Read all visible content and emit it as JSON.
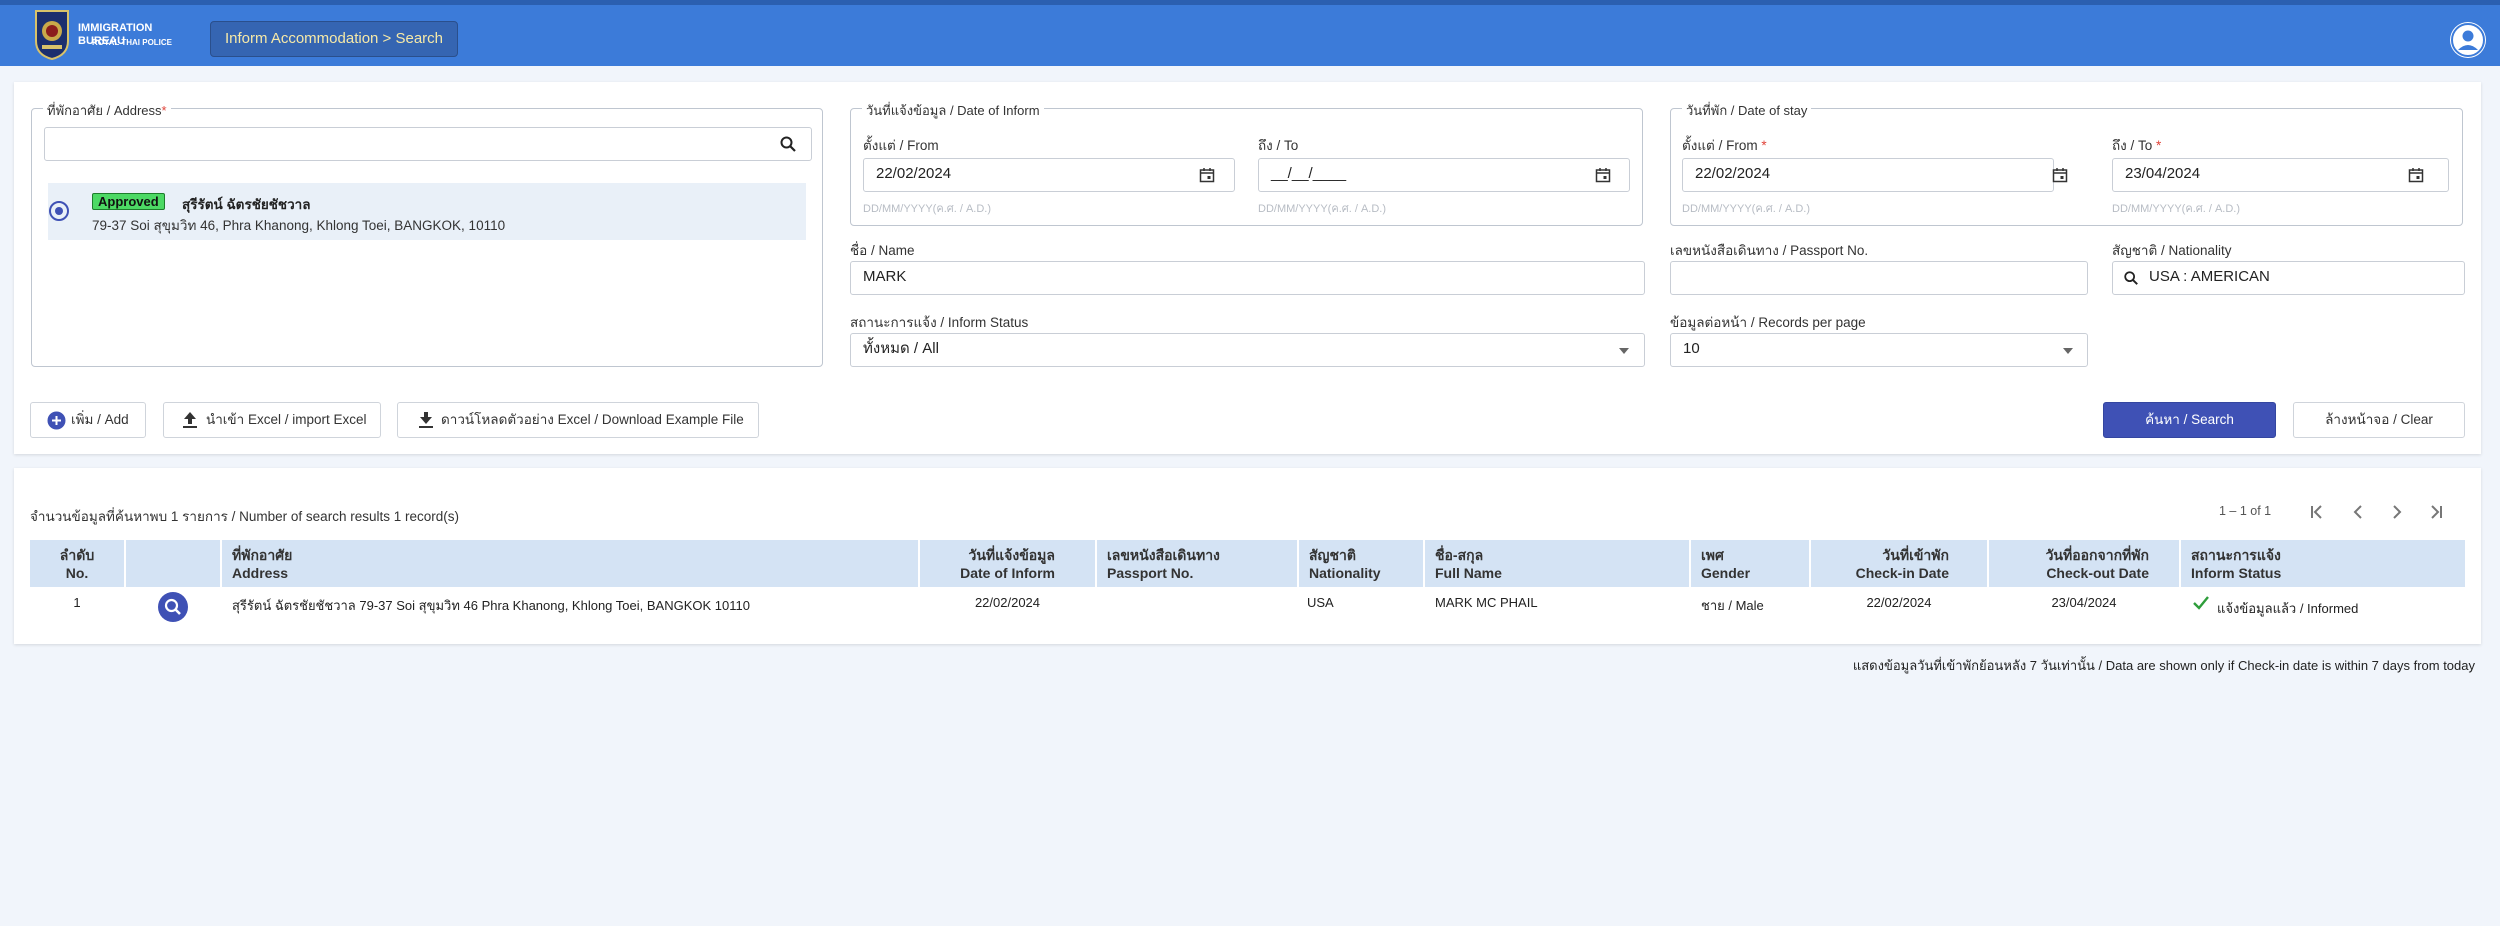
{
  "header": {
    "logo_line1": "IMMIGRATION BUREAU",
    "logo_line2": "ROYAL THAI POLICE",
    "breadcrumb": "Inform Accommodation > Search"
  },
  "address": {
    "legend": "ที่พักอาศัย / Address",
    "search_value": "",
    "item": {
      "badge": "Approved",
      "name": "สุรีรัตน์ ฉัตรชัยชัชวาล",
      "address": "79-37 Soi สุขุมวิท 46, Phra Khanong, Khlong Toei, BANGKOK, 10110"
    }
  },
  "date_inform": {
    "legend": "วันที่แจ้งข้อมูล / Date of Inform",
    "from_label": "ตั้งแต่ / From",
    "from_value": "22/02/2024",
    "from_hint": "DD/MM/YYYY(ค.ศ. / A.D.)",
    "to_label": "ถึง / To",
    "to_value": "__/__/____",
    "to_hint": "DD/MM/YYYY(ค.ศ. / A.D.)"
  },
  "date_stay": {
    "legend": "วันที่พัก / Date of stay",
    "from_label": "ตั้งแต่ / From",
    "from_value": "22/02/2024",
    "from_hint": "DD/MM/YYYY(ค.ศ. / A.D.)",
    "to_label": "ถึง / To",
    "to_value": "23/04/2024",
    "to_hint": "DD/MM/YYYY(ค.ศ. / A.D.)"
  },
  "name": {
    "label": "ชื่อ / Name",
    "value": "MARK"
  },
  "passport": {
    "label": "เลขหนังสือเดินทาง / Passport No.",
    "value": ""
  },
  "nationality": {
    "label": "สัญชาติ / Nationality",
    "value": "USA : AMERICAN"
  },
  "inform_status": {
    "label": "สถานะการแจ้ง / Inform Status",
    "value": "ทั้งหมด / All"
  },
  "records_per_page": {
    "label": "ข้อมูลต่อหน้า / Records per page",
    "value": "10"
  },
  "buttons": {
    "add": "เพิ่ม / Add",
    "import": "นำเข้า Excel / import Excel",
    "download": "ดาวน์โหลดตัวอย่าง Excel / Download Example File",
    "search": "ค้นหา / Search",
    "clear": "ล้างหน้าจอ / Clear"
  },
  "results": {
    "count_text": "จำนวนข้อมูลที่ค้นหาพบ 1 รายการ / Number of search results 1 record(s)",
    "pagination": "1 – 1 of 1",
    "columns": [
      {
        "th": "ลำดับ",
        "en": "No."
      },
      {
        "th": "",
        "en": ""
      },
      {
        "th": "ที่พักอาศัย",
        "en": "Address"
      },
      {
        "th": "วันที่แจ้งข้อมูล",
        "en": "Date of Inform"
      },
      {
        "th": "เลขหนังสือเดินทาง",
        "en": "Passport No."
      },
      {
        "th": "สัญชาติ",
        "en": "Nationality"
      },
      {
        "th": "ชื่อ-สกุล",
        "en": "Full Name"
      },
      {
        "th": "เพศ",
        "en": "Gender"
      },
      {
        "th": "วันที่เข้าพัก",
        "en": "Check-in Date"
      },
      {
        "th": "วันที่ออกจากที่พัก",
        "en": "Check-out Date"
      },
      {
        "th": "สถานะการแจ้ง",
        "en": "Inform Status"
      }
    ],
    "row": {
      "no": "1",
      "address": "สุรีรัตน์ ฉัตรชัยชัชวาล 79-37 Soi สุขุมวิท 46 Phra Khanong, Khlong Toei, BANGKOK 10110",
      "date_inform": "22/02/2024",
      "passport": "",
      "nationality": "USA",
      "full_name": "MARK MC PHAIL",
      "gender": "ชาย / Male",
      "checkin": "22/02/2024",
      "checkout": "23/04/2024",
      "status": "แจ้งข้อมูลแล้ว / Informed"
    }
  },
  "footer_note": "แสดงข้อมูลวันที่เข้าพักย้อนหลัง 7 วันเท่านั้น / Data are shown only if Check-in date is within 7 days from today",
  "colors": {
    "header": "#3c7bd9",
    "primary_button": "#3f51b5",
    "approved_badge": "#4cd964",
    "informed_check": "#2e9d3b"
  }
}
